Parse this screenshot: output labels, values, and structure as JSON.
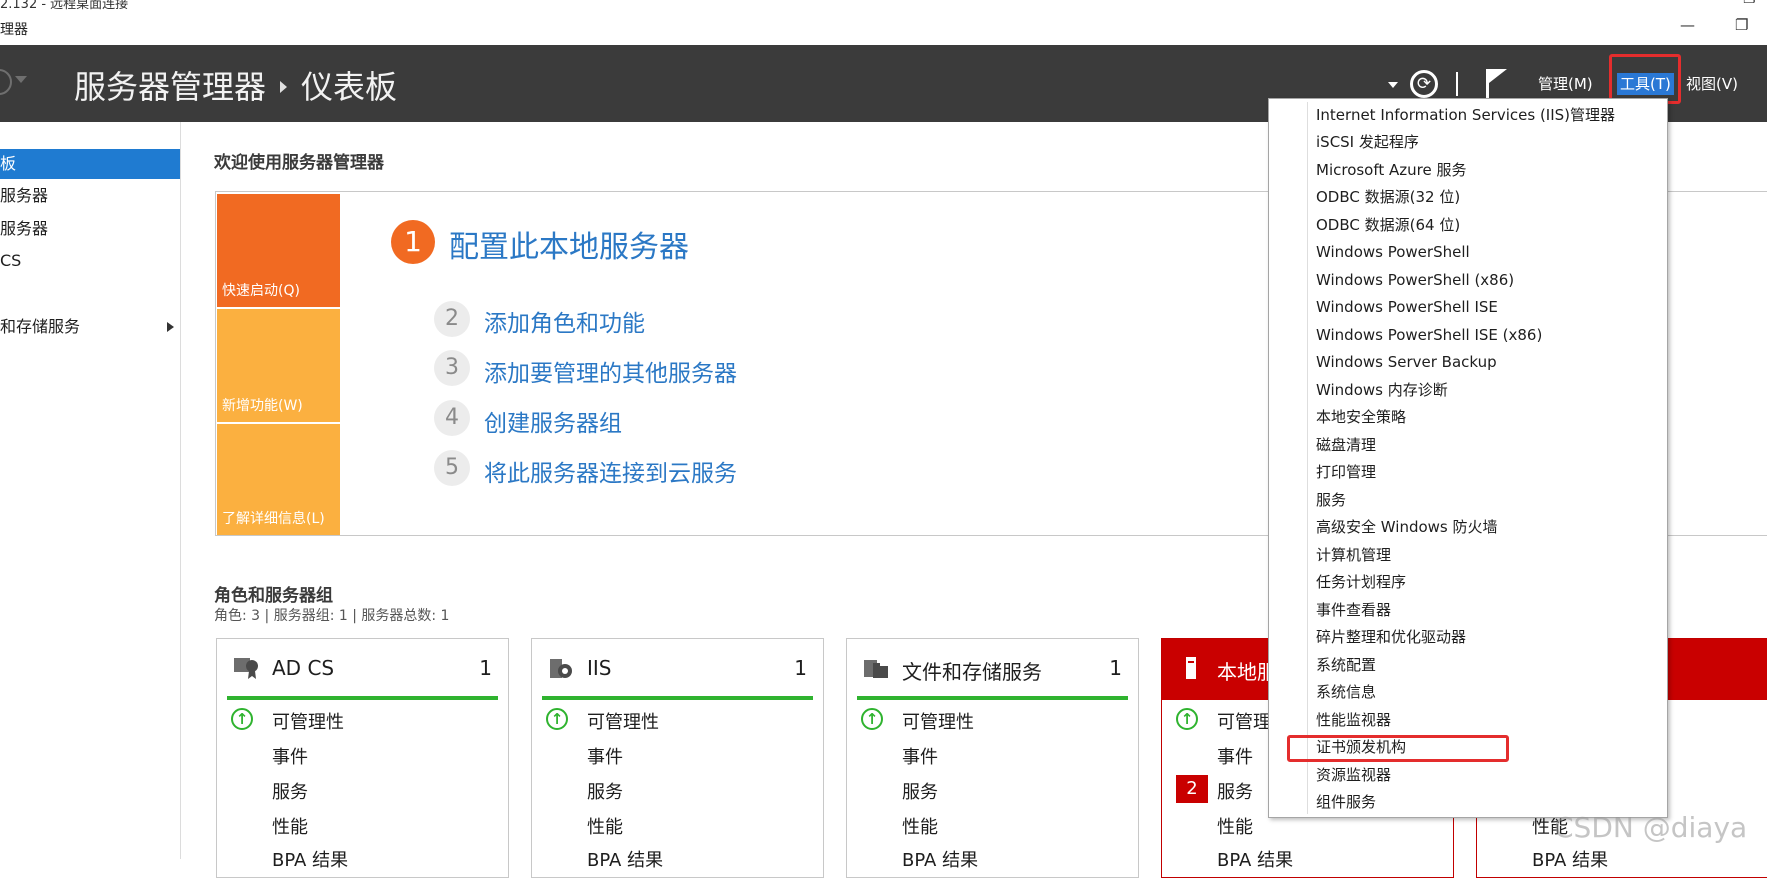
{
  "window": {
    "rdp_title": "2.132 - 远程桌面连接",
    "app_title": "理器",
    "min_glyph": "—",
    "restore_glyph": "❐"
  },
  "header": {
    "breadcrumb_app": "服务器管理器",
    "breadcrumb_page": "仪表板",
    "refresh_glyph": "⟳",
    "menus": {
      "manage": "管理(M)",
      "tools": "工具(T)",
      "view": "视图(V)"
    }
  },
  "sidebar": {
    "items": [
      {
        "label": "板",
        "active": true
      },
      {
        "label": "服务器"
      },
      {
        "label": "服务器"
      },
      {
        "label": "CS"
      },
      {
        "label": "和存储服务",
        "expandable": true
      }
    ]
  },
  "welcome": {
    "title": "欢迎使用服务器管理器",
    "tiles": {
      "quick_start": "快速启动(Q)",
      "whats_new": "新增功能(W)",
      "learn_more": "了解详细信息(L)"
    },
    "main_step": {
      "num": "1",
      "label": "配置此本地服务器"
    },
    "steps": [
      {
        "num": "2",
        "label": "添加角色和功能"
      },
      {
        "num": "3",
        "label": "添加要管理的其他服务器"
      },
      {
        "num": "4",
        "label": "创建服务器组"
      },
      {
        "num": "5",
        "label": "将此服务器连接到云服务"
      }
    ]
  },
  "roles": {
    "title": "角色和服务器组",
    "subtitle": "角色: 3 | 服务器组: 1 | 服务器总数: 1",
    "cards": [
      {
        "name": "AD CS",
        "count": "1",
        "rows": [
          "可管理性",
          "事件",
          "服务",
          "性能",
          "BPA 结果"
        ]
      },
      {
        "name": "IIS",
        "count": "1",
        "rows": [
          "可管理性",
          "事件",
          "服务",
          "性能",
          "BPA 结果"
        ]
      },
      {
        "name": "文件和存储服务",
        "count": "1",
        "rows": [
          "可管理性",
          "事件",
          "服务",
          "性能",
          "BPA 结果"
        ]
      },
      {
        "name": "本地服",
        "count": "",
        "badge": "2",
        "rows": [
          "可管理性",
          "事件",
          "服务",
          "性能",
          "BPA 结果"
        ]
      },
      {
        "rows": [
          "性能",
          "BPA 结果"
        ]
      }
    ]
  },
  "tools_menu": {
    "items": [
      "Internet Information Services (IIS)管理器",
      "iSCSI 发起程序",
      "Microsoft Azure 服务",
      "ODBC 数据源(32 位)",
      "ODBC 数据源(64 位)",
      "Windows PowerShell",
      "Windows PowerShell (x86)",
      "Windows PowerShell ISE",
      "Windows PowerShell ISE (x86)",
      "Windows Server Backup",
      "Windows 内存诊断",
      "本地安全策略",
      "磁盘清理",
      "打印管理",
      "服务",
      "高级安全 Windows 防火墙",
      "计算机管理",
      "任务计划程序",
      "事件查看器",
      "碎片整理和优化驱动器",
      "系统配置",
      "系统信息",
      "性能监视器",
      "证书颁发机构",
      "资源监视器",
      "组件服务"
    ],
    "highlighted_index": 23
  },
  "watermark": "CSDN @diaya",
  "colors": {
    "header_bg": "#3b3b3b",
    "accent_blue": "#1f7bd1",
    "tile_orange": "#f16a22",
    "tile_amber": "#fbb040",
    "healthy_green": "#2fb32f",
    "alert_red": "#c90000",
    "annotation_red": "#e42d2d",
    "link_blue": "#2b78c5"
  }
}
